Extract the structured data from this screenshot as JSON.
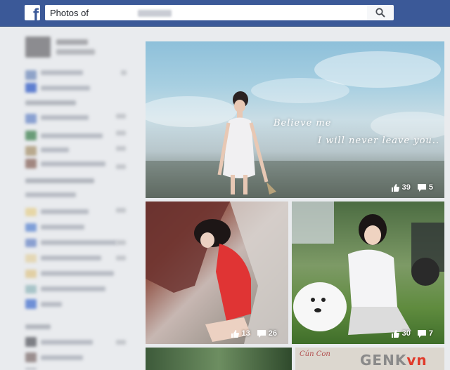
{
  "header": {
    "logo": "f",
    "search_value": "Photos of",
    "search_icon": "search-icon",
    "brand_color": "#3b5998"
  },
  "photos": [
    {
      "caption_lines": [
        "Believe me",
        "I will never leave you.."
      ],
      "likes": "39",
      "comments": "5"
    },
    {
      "caption_lines": [],
      "likes": "13",
      "comments": "26"
    },
    {
      "caption_lines": [],
      "likes": "30",
      "comments": "7"
    },
    {
      "caption_lines": []
    },
    {
      "watermark": "GENK",
      "watermark_accent": "vn",
      "partial_text": "Cún Con"
    }
  ]
}
